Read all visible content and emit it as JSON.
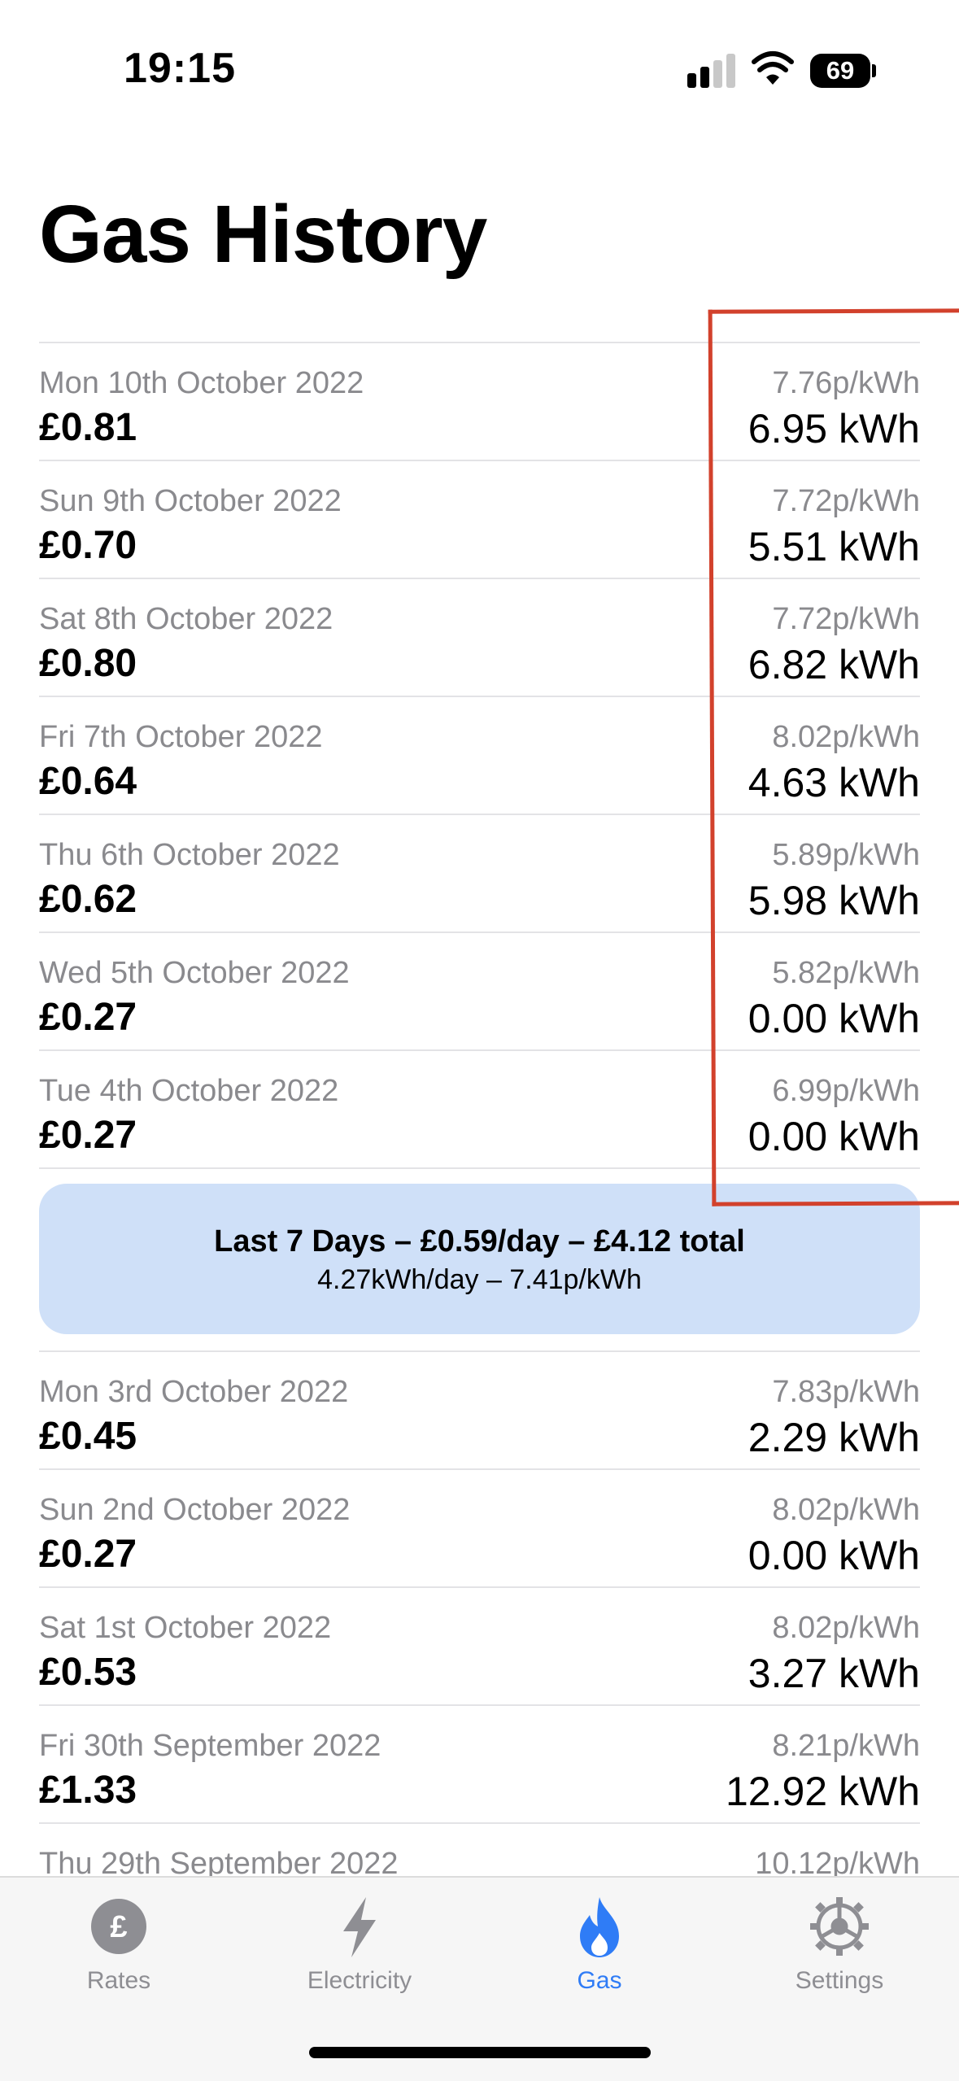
{
  "status_bar": {
    "time": "19:15",
    "battery": "69"
  },
  "page": {
    "title": "Gas History"
  },
  "entries_recent": [
    {
      "date": "Mon 10th October 2022",
      "cost": "£0.81",
      "rate": "7.76p/kWh",
      "usage": "6.95 kWh"
    },
    {
      "date": "Sun 9th October 2022",
      "cost": "£0.70",
      "rate": "7.72p/kWh",
      "usage": "5.51 kWh"
    },
    {
      "date": "Sat 8th October 2022",
      "cost": "£0.80",
      "rate": "7.72p/kWh",
      "usage": "6.82 kWh"
    },
    {
      "date": "Fri 7th October 2022",
      "cost": "£0.64",
      "rate": "8.02p/kWh",
      "usage": "4.63 kWh"
    },
    {
      "date": "Thu 6th October 2022",
      "cost": "£0.62",
      "rate": "5.89p/kWh",
      "usage": "5.98 kWh"
    },
    {
      "date": "Wed 5th October 2022",
      "cost": "£0.27",
      "rate": "5.82p/kWh",
      "usage": "0.00 kWh"
    },
    {
      "date": "Tue 4th October 2022",
      "cost": "£0.27",
      "rate": "6.99p/kWh",
      "usage": "0.00 kWh"
    }
  ],
  "summary": {
    "title": "Last 7 Days – £0.59/day – £4.12 total",
    "subtitle": "4.27kWh/day – 7.41p/kWh"
  },
  "entries_older": [
    {
      "date": "Mon 3rd October 2022",
      "cost": "£0.45",
      "rate": "7.83p/kWh",
      "usage": "2.29 kWh"
    },
    {
      "date": "Sun 2nd October 2022",
      "cost": "£0.27",
      "rate": "8.02p/kWh",
      "usage": "0.00 kWh"
    },
    {
      "date": "Sat 1st October 2022",
      "cost": "£0.53",
      "rate": "8.02p/kWh",
      "usage": "3.27 kWh"
    },
    {
      "date": "Fri 30th September 2022",
      "cost": "£1.33",
      "rate": "8.21p/kWh",
      "usage": "12.92 kWh"
    },
    {
      "date": "Thu 29th September 2022",
      "cost": "",
      "rate": "10.12p/kWh",
      "usage": ""
    }
  ],
  "tabs": [
    {
      "label": "Rates",
      "icon": "pound-coin-icon",
      "active": false
    },
    {
      "label": "Electricity",
      "icon": "lightning-bolt-icon",
      "active": false
    },
    {
      "label": "Gas",
      "icon": "flame-icon",
      "active": true
    },
    {
      "label": "Settings",
      "icon": "gear-icon",
      "active": false
    }
  ],
  "colors": {
    "accent": "#2f7cf6",
    "summary_background": "#cfe0f8",
    "annotation": "#d2412c",
    "secondary_text": "#8a8a8e"
  }
}
